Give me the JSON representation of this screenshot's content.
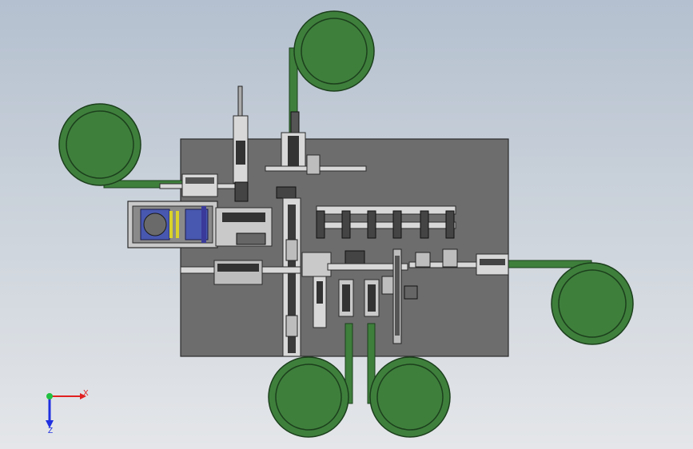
{
  "viewport": {
    "title": ""
  },
  "triad": {
    "x_label": "X",
    "z_label": "Z",
    "x_color": "#e02020",
    "y_color": "#20c040",
    "z_color": "#2030e0"
  },
  "colors": {
    "plate": "#6d6d6d",
    "plate_edge": "#2b2b2b",
    "coil": "#3e7f3c",
    "coil_edge": "#1c3f1c",
    "machine": "#d8d8d8",
    "machine_dark": "#2a2a2a",
    "accent_yellow": "#d9d32a",
    "accent_blue": "#4858b0"
  }
}
